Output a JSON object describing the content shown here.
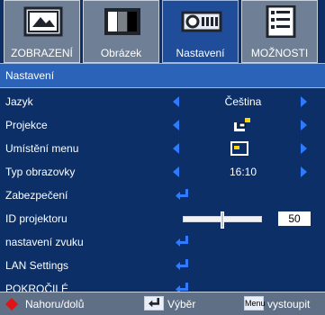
{
  "tabs": [
    {
      "label": "ZOBRAZENÍ",
      "icon": "display-image-icon",
      "active": false
    },
    {
      "label": "Obrázek",
      "icon": "picture-bars-icon",
      "active": false
    },
    {
      "label": "Nastavení",
      "icon": "projector-icon",
      "active": true
    },
    {
      "label": "MOŽNOSTI",
      "icon": "options-checklist-icon",
      "active": false
    }
  ],
  "header": {
    "title": "Nastavení"
  },
  "rows": [
    {
      "label": "Jazyk",
      "value": "Čeština"
    },
    {
      "label": "Projekce",
      "value_icon": "projection-mode-icon"
    },
    {
      "label": "Umístění menu",
      "value_icon": "menu-position-icon"
    },
    {
      "label": "Typ obrazovky",
      "value": "16:10"
    },
    {
      "label": "Zabezpečení",
      "action_icon": "enter-icon"
    },
    {
      "label": "ID projektoru",
      "slider": {
        "value": 50,
        "max": 99
      },
      "display_value": "50"
    },
    {
      "label": "nastavení zvuku",
      "action_icon": "enter-icon"
    },
    {
      "label": "LAN Settings",
      "action_icon": "enter-icon"
    },
    {
      "label": "POKROČILÉ",
      "action_icon": "enter-icon"
    }
  ],
  "footer": {
    "nav": "Nahoru/dolů",
    "enter_key": "",
    "select": "Výběr",
    "menu_key": "Menu",
    "exit": "vystoupit"
  },
  "colors": {
    "accent": "#2f7bff",
    "header": "#2a63b7",
    "active_tab": "#1f4d9a",
    "inactive_tab": "#6f7f96"
  }
}
